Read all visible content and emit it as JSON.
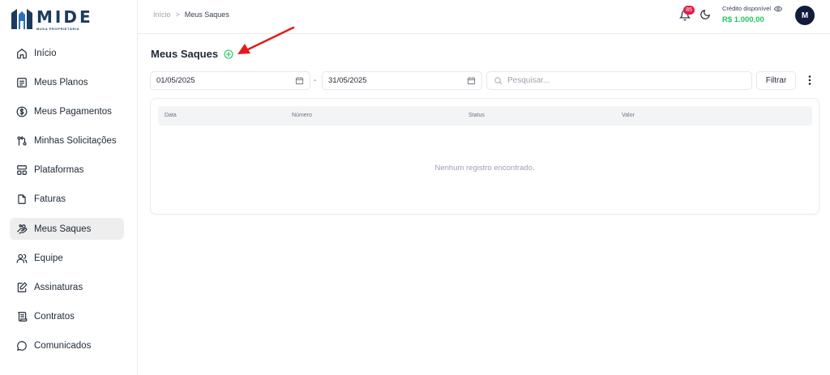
{
  "brand": {
    "name": "MIDE",
    "tagline": "MUSA PROPRIETÁRIA",
    "color": "#1d3a5f"
  },
  "sidebar": {
    "items": [
      {
        "label": "Início",
        "icon": "home-icon"
      },
      {
        "label": "Meus Planos",
        "icon": "list-icon"
      },
      {
        "label": "Meus Pagamentos",
        "icon": "dollar-icon"
      },
      {
        "label": "Minhas Solicitações",
        "icon": "git-pull-icon"
      },
      {
        "label": "Plataformas",
        "icon": "layout-icon"
      },
      {
        "label": "Faturas",
        "icon": "file-icon"
      },
      {
        "label": "Meus Saques",
        "icon": "hand-coins-icon",
        "active": true
      },
      {
        "label": "Equipe",
        "icon": "users-icon"
      },
      {
        "label": "Assinaturas",
        "icon": "signature-icon"
      },
      {
        "label": "Contratos",
        "icon": "scroll-icon"
      },
      {
        "label": "Comunicados",
        "icon": "message-icon"
      }
    ]
  },
  "header": {
    "breadcrumb": {
      "home": "Início",
      "separator": ">",
      "current": "Meus Saques"
    },
    "notifications_count": "85",
    "credit_label": "Crédito disponível",
    "credit_value": "R$ 1.000,00",
    "avatar_initial": "M",
    "credit_color": "#22c55e",
    "badge_color": "#e11d48"
  },
  "main": {
    "title": "Meus Saques",
    "date_from": "01/05/2025",
    "date_to": "31/05/2025",
    "date_separator": "-",
    "search_placeholder": "Pesquisar...",
    "filter_label": "Filtrar",
    "table": {
      "columns": [
        "Data",
        "Número",
        "Status",
        "Valor"
      ],
      "empty_message": "Nenhum registro encontrado."
    }
  }
}
